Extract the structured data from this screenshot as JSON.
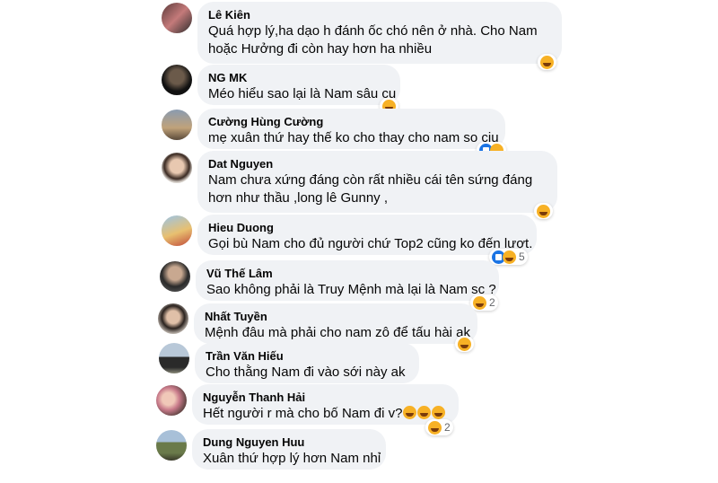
{
  "comments": [
    {
      "author": "Lê Kiên",
      "lines": [
        "Quá hợp lý,ha dạo h đánh ốc chó nên ở nhà. Cho Nam",
        "hoặc Hưởng đi còn hay hơn ha nhiều"
      ],
      "reactions": [
        "haha"
      ],
      "count": ""
    },
    {
      "author": "NG MK",
      "lines": [
        "Méo hiểu sao lại là Nam sâu cu"
      ],
      "reactions": [
        "haha"
      ],
      "count": ""
    },
    {
      "author": "Cường Hùng Cường",
      "lines": [
        "mẹ xuân thứ hay thế ko cho thay cho nam so ciu"
      ],
      "reactions": [
        "like",
        "haha"
      ],
      "count": ""
    },
    {
      "author": "Dat Nguyen",
      "lines": [
        "Nam chưa xứng đáng còn rất nhiều cái tên sứng đáng",
        "hơn như thầu ,long lê Gunny ,"
      ],
      "reactions": [
        "haha"
      ],
      "count": ""
    },
    {
      "author": "Hieu Duong",
      "lines": [
        "Gọi bù Nam cho đủ người chứ Top2 cũng ko đến lượt."
      ],
      "reactions": [
        "like",
        "haha"
      ],
      "count": "5"
    },
    {
      "author": "Vũ Thế Lâm",
      "lines": [
        "Sao không phải là Truy Mệnh mà lại là Nam sc ?"
      ],
      "reactions": [
        "haha"
      ],
      "count": "2"
    },
    {
      "author": "Nhất Tuyền",
      "lines": [
        "Mệnh đâu mà phải cho nam zô để tấu hài ak"
      ],
      "reactions": [
        "haha"
      ],
      "count": ""
    },
    {
      "author": "Trần Văn Hiếu",
      "lines": [
        "Cho thằng Nam đi vào sới này ak"
      ],
      "reactions": [],
      "count": ""
    },
    {
      "author": "Nguyễn Thanh Hải",
      "lines": [
        "Hết người r mà cho bố Nam đi v?"
      ],
      "inline_emoji": 3,
      "reactions": [
        "haha"
      ],
      "count": "2"
    },
    {
      "author": "Dung Nguyen Huu",
      "lines": [
        "Xuân thứ hợp lý hơn Nam nhỉ"
      ],
      "reactions": [],
      "count": ""
    }
  ],
  "colors": {
    "bubble": "#f0f2f5",
    "haha": "#f7b125",
    "like": "#1b74e4"
  }
}
